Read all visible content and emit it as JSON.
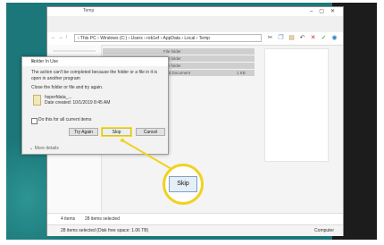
{
  "explorer": {
    "title": "Temp",
    "address": "› This PC  ›  Windows (C:)  ›  Users  ›  rob1ef  ›  AppData  ›  Local  ›  Temp",
    "file_rows": [
      {
        "type": "File folder",
        "size": ""
      },
      {
        "type": "File folder",
        "size": ""
      },
      {
        "type": "File folder",
        "size": ""
      },
      {
        "type": "Text Document",
        "size": "1 KB"
      }
    ],
    "status_items": "4 items",
    "status_selected": "28 items selected",
    "status_bottom": "28 items selected (Disk free space: 1.06 TB)",
    "status_location": "Computer"
  },
  "dialog": {
    "title": "Folder In Use",
    "message": "The action can't be completed because the folder or a file in it is open in another program",
    "instruction": "Close the folder or file and try again.",
    "file_name": "hsperfdata_...",
    "file_date": "Date created: 10/1/2019 8:45 AM",
    "checkbox_label": "Do this for all current items",
    "try_again": "Try Again",
    "skip": "Skip",
    "cancel": "Cancel",
    "more_details": "More details"
  },
  "callout": {
    "label": "Skip"
  },
  "colors": {
    "desktop": "#1b7779",
    "highlight": "#f1d21f"
  }
}
